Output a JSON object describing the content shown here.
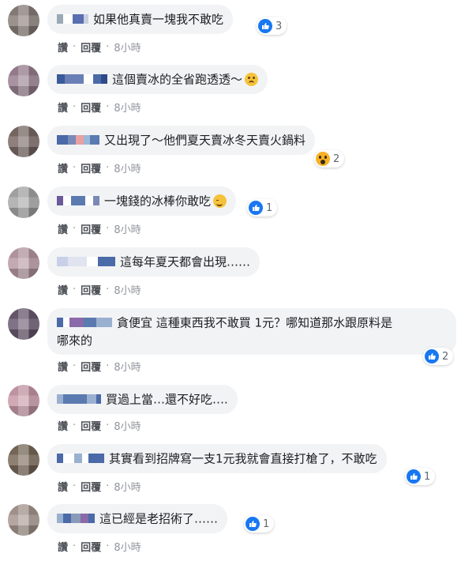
{
  "actions": {
    "like": "讚",
    "reply": "回覆",
    "separator": "·"
  },
  "colors": {
    "like_blue": "#1877f2",
    "bubble_bg": "#f2f3f5",
    "wow_yellow": "#f7b125"
  },
  "comments": [
    {
      "text": "如果他真賣一塊我不敢吃",
      "time": "8小時",
      "reaction_icons": [
        "like-icon"
      ],
      "reaction_count": "3"
    },
    {
      "text": "這個賣冰的全省跑透透～",
      "emoji": "weary-face-emoji",
      "time": "8小時"
    },
    {
      "text": "又出現了～他們夏天賣冰冬天賣火鍋料",
      "time": "8小時",
      "reaction_icons": [
        "wow-icon"
      ],
      "reaction_count": "2"
    },
    {
      "text": "一塊錢的冰棒你敢吃",
      "emoji": "relieved-face-emoji",
      "time": "8小時",
      "reaction_icons": [
        "like-icon"
      ],
      "reaction_count": "1"
    },
    {
      "text": "這每年夏天都會出現……",
      "time": "8小時"
    },
    {
      "text_line1": "貪便宜 這種東西我不敢買 1元？哪知道那水跟原料是",
      "text_line2": "哪來的",
      "time": "8小時",
      "reaction_icons": [
        "like-icon"
      ],
      "reaction_count": "2"
    },
    {
      "text": "買過上當…還不好吃….",
      "time": "8小時"
    },
    {
      "text": "其實看到招牌寫一支1元我就會直接打槍了，不敢吃",
      "time": "8小時",
      "reaction_icons": [
        "like-icon"
      ],
      "reaction_count": "1"
    },
    {
      "text": "這已經是老招術了……",
      "time": "8小時",
      "reaction_icons": [
        "like-icon"
      ],
      "reaction_count": "1"
    }
  ]
}
